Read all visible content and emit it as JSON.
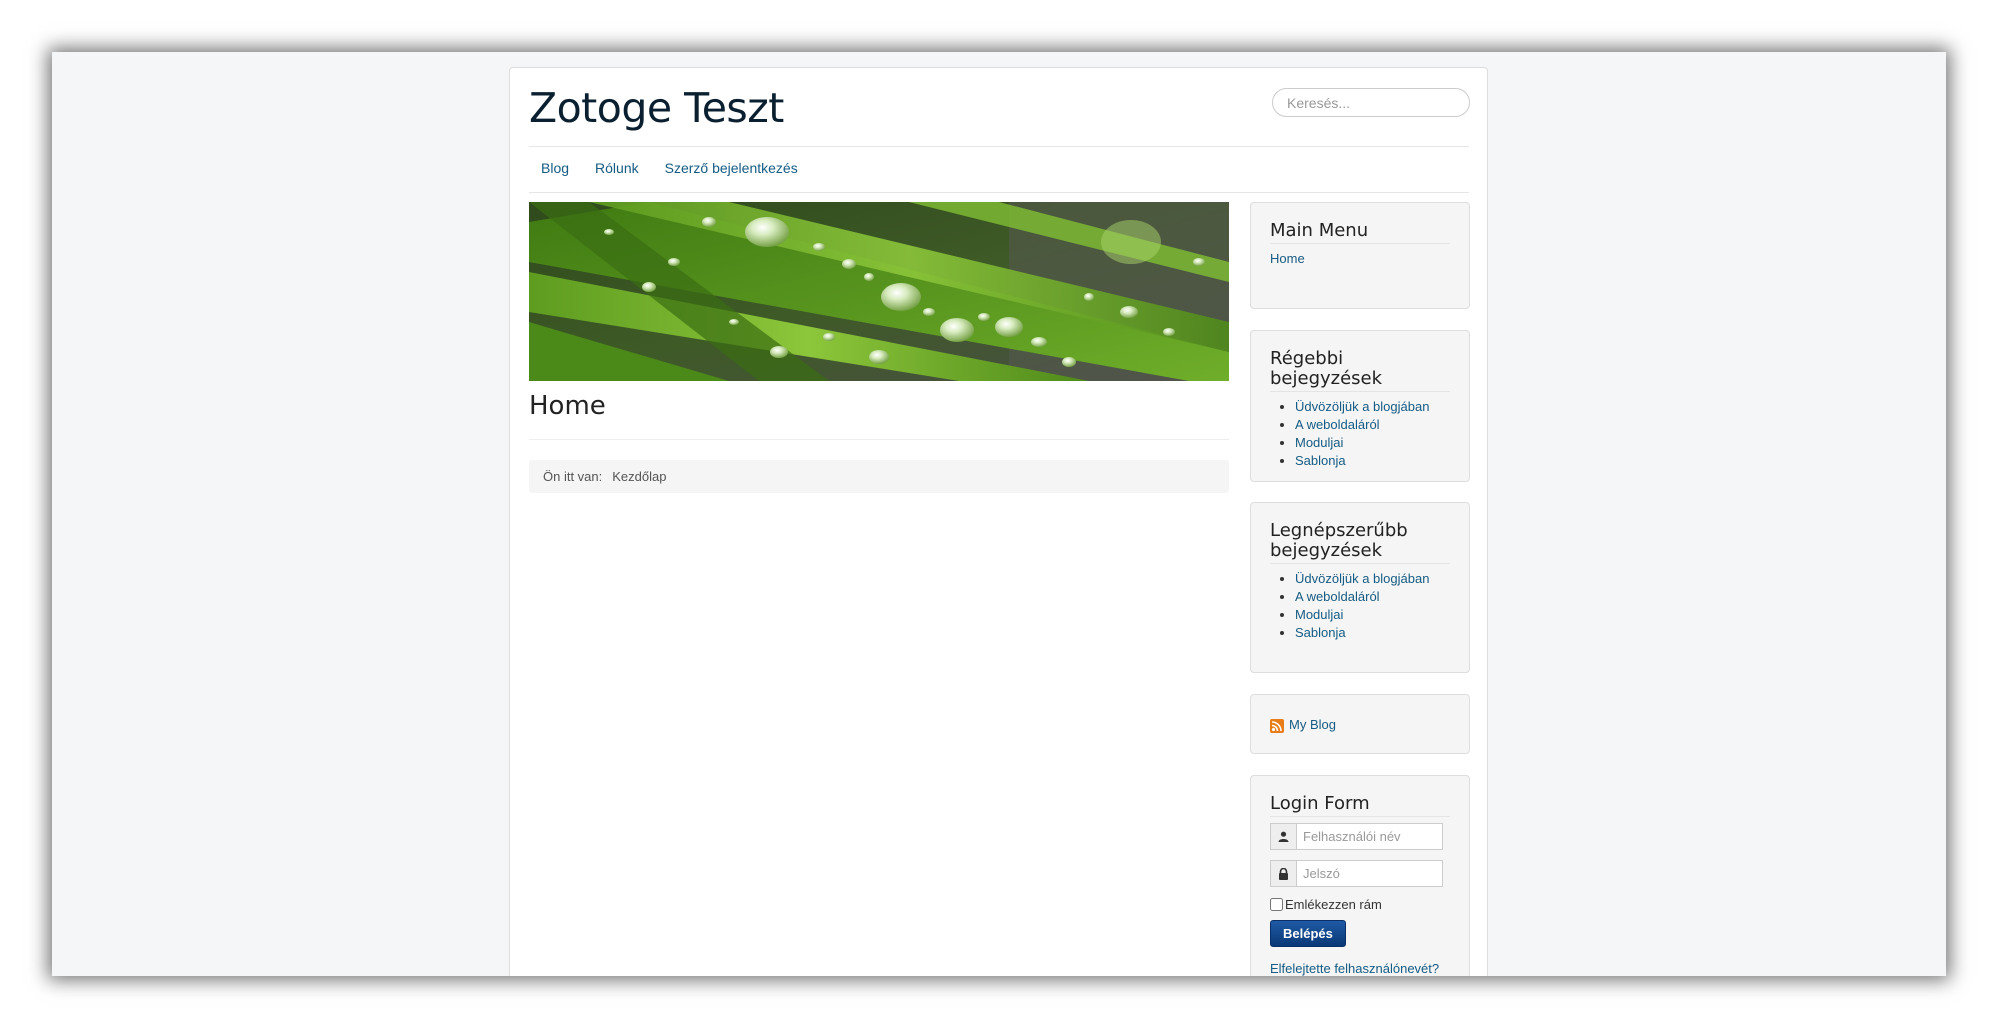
{
  "site": {
    "title": "Zotoge Teszt"
  },
  "search": {
    "placeholder": "Keresés..."
  },
  "nav": {
    "items": [
      "Blog",
      "Rólunk",
      "Szerző bejelentkezés"
    ]
  },
  "main": {
    "heading": "Home",
    "breadcrumb": {
      "label": "Ön itt van:",
      "current": "Kezdőlap"
    }
  },
  "sidebar": {
    "main_menu": {
      "title": "Main Menu",
      "items": [
        "Home"
      ]
    },
    "older_posts": {
      "title": "Régebbi bejegyzések",
      "items": [
        "Üdvözöljük a blogjában",
        "A weboldaláról",
        "Moduljai",
        "Sablonja"
      ]
    },
    "popular_posts": {
      "title": "Legnépszerűbb bejegyzések",
      "items": [
        "Üdvözöljük a blogjában",
        "A weboldaláról",
        "Moduljai",
        "Sablonja"
      ]
    },
    "feed": {
      "label": "My Blog",
      "icon": "rss-icon"
    },
    "login": {
      "title": "Login Form",
      "username_placeholder": "Felhasználói név",
      "password_placeholder": "Jelszó",
      "remember_label": "Emlékezzen rám",
      "submit_label": "Belépés",
      "forgot_label": "Elfelejtette felhasználónevét?"
    }
  },
  "colors": {
    "link": "#165b83",
    "title": "#0a2030",
    "button": "#0a3877"
  }
}
